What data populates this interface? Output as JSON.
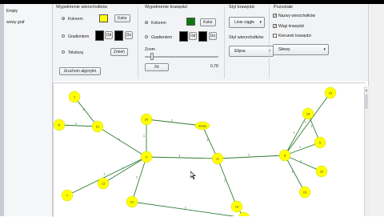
{
  "sidebar": {
    "items": [
      {
        "label": "Empty"
      },
      {
        "label": "wowy graf"
      }
    ]
  },
  "toolbar": {
    "vertex_fill": {
      "title": "Wypełnienie wierzchołków",
      "color_radio": "Kolorem",
      "gradient_radio": "Gradientem",
      "texture_radio": "Teksturą",
      "color_button": "Kolor",
      "from_button": "Od",
      "to_button": "Do",
      "change_button": "Zmień",
      "swatch_color": "#ffff00",
      "grad_from_color": "#000000",
      "grad_to_color": "#000000"
    },
    "run_algorithm_button": "Uruchom algorytm",
    "edge_fill": {
      "title": "Wypełnienie krawędzi",
      "color_radio": "Kolorem",
      "gradient_radio": "Gradientem",
      "color_button": "Kolor",
      "from_button": "Od",
      "to_button": "Do",
      "swatch_color": "#0b7a0b",
      "grad_from_color": "#000000",
      "grad_to_color": "#000000"
    },
    "zoom": {
      "label": "Zoom",
      "value": "0,78",
      "level": 0.1,
      "fit_button": "Fit"
    },
    "edge_style": {
      "title": "Styl krawędzi",
      "value": "Linie ciągłe"
    },
    "vertex_style": {
      "title": "Styl wierzchołków",
      "value": "Elipsa"
    },
    "other": {
      "title": "Pozostałe",
      "vertex_names": "Nazwy wierzchołków",
      "edge_weights": "Wagi krawędzi",
      "edge_direction": "Kierunek krawędzi",
      "layout_value": "Siłowy"
    }
  },
  "graph": {
    "nodes": [
      {
        "id": "1",
        "label": "1"
      },
      {
        "id": "6",
        "label": "6"
      },
      {
        "id": "21",
        "label": "21"
      },
      {
        "id": "20",
        "label": "20"
      },
      {
        "id": "9",
        "label": "9"
      },
      {
        "id": "13",
        "label": "13"
      },
      {
        "id": "7",
        "label": "7"
      },
      {
        "id": "12",
        "label": "12"
      },
      {
        "id": "wowy",
        "label": "wowy"
      },
      {
        "id": "11",
        "label": "11"
      },
      {
        "id": "19",
        "label": "19"
      },
      {
        "id": "18",
        "label": "18"
      },
      {
        "id": "5",
        "label": "5"
      },
      {
        "id": "8",
        "label": "8"
      },
      {
        "id": "16",
        "label": "16"
      },
      {
        "id": "15",
        "label": "15"
      },
      {
        "id": "14",
        "label": "14"
      },
      {
        "id": "bottom",
        "label": ""
      }
    ],
    "edges": [
      {
        "from": "1",
        "to": "21",
        "w": "1"
      },
      {
        "from": "6",
        "to": "21",
        "w": "1"
      },
      {
        "from": "21",
        "to": "9",
        "w": "1"
      },
      {
        "from": "20",
        "to": "9",
        "w": "1"
      },
      {
        "from": "20",
        "to": "wowy",
        "w": "1"
      },
      {
        "from": "wowy",
        "to": "11",
        "w": "1"
      },
      {
        "from": "9",
        "to": "13",
        "w": "1"
      },
      {
        "from": "9",
        "to": "7",
        "w": "1"
      },
      {
        "from": "9",
        "to": "12",
        "w": "1"
      },
      {
        "from": "9",
        "to": "11",
        "w": "1"
      },
      {
        "from": "11",
        "to": "8",
        "w": "1"
      },
      {
        "from": "11",
        "to": "14",
        "w": "1"
      },
      {
        "from": "8",
        "to": "19",
        "w": "1"
      },
      {
        "from": "8",
        "to": "18",
        "w": "1"
      },
      {
        "from": "8",
        "to": "5",
        "w": "1"
      },
      {
        "from": "8",
        "to": "16",
        "w": "1"
      },
      {
        "from": "8",
        "to": "15",
        "w": "1"
      },
      {
        "from": "18",
        "to": "5",
        "w": "1"
      },
      {
        "from": "14",
        "to": "bottom",
        "w": "1"
      },
      {
        "from": "12",
        "to": "bottom",
        "w": "1"
      }
    ]
  }
}
